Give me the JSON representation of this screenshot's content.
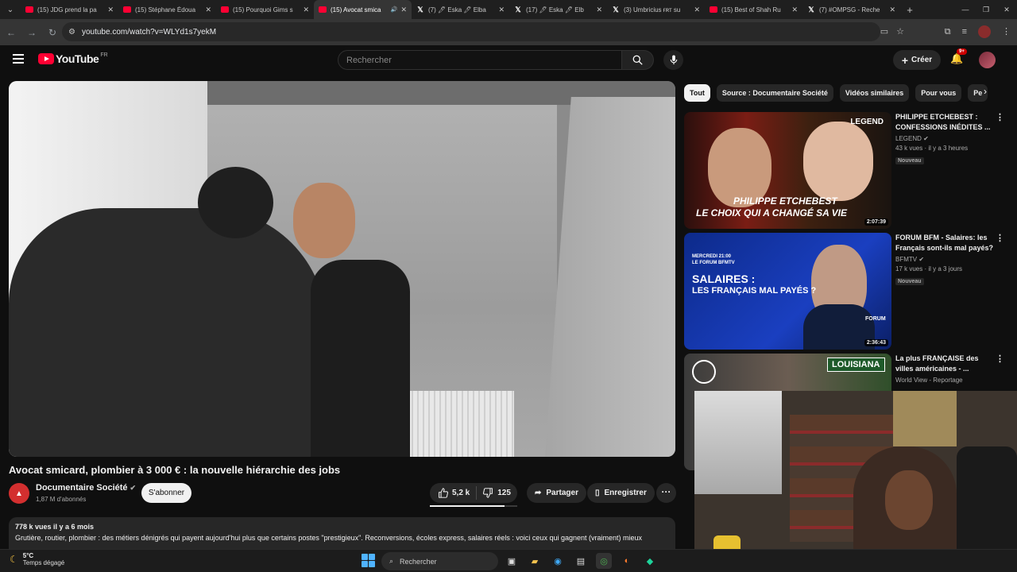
{
  "browser": {
    "tabs": [
      {
        "title": "(15) JDG prend la pa",
        "favicon": "youtube-icon"
      },
      {
        "title": "(15) Stéphane Édoua",
        "favicon": "youtube-icon"
      },
      {
        "title": "(15) Pourquoi Gims s",
        "favicon": "youtube-icon"
      },
      {
        "title": "(15) Avocat smica",
        "favicon": "youtube-icon",
        "active": true
      },
      {
        "title": "(7) 🖊 Eska 🖊 Elba",
        "favicon": "x-icon"
      },
      {
        "title": "(17) 🖊 Eska 🖊 Elb",
        "favicon": "x-icon"
      },
      {
        "title": "(3) Umbricius ғʀт su",
        "favicon": "x-icon"
      },
      {
        "title": "(15) Best of Shah Ru",
        "favicon": "youtube-icon"
      },
      {
        "title": "(7) #OMPSG - Reche",
        "favicon": "x-icon"
      }
    ],
    "url": "youtube.com/watch?v=WLYd1s7yekM"
  },
  "youtube": {
    "logo_text": "YouTube",
    "country": "FR",
    "search_placeholder": "Rechercher",
    "create_label": "Créer",
    "notification_count": "9+"
  },
  "video": {
    "title": "Avocat smicard, plombier à 3 000 € : la nouvelle hiérarchie des jobs",
    "channel": "Documentaire Société",
    "subscribers": "1,87 M d'abonnés",
    "subscribe_label": "S'abonner",
    "likes": "5,2 k",
    "dislikes": "125",
    "like_ratio": 0.85,
    "share_label": "Partager",
    "save_label": "Enregistrer",
    "stats": "778 k vues  il y a 6 mois",
    "description": "Grutière, routier, plombier : des métiers dénigrés qui payent aujourd'hui plus que certains postes \"prestigieux\". Reconversions, écoles express, salaires réels : voici ceux qui gagnent (vraiment) mieux"
  },
  "sidebar": {
    "chips": [
      "Tout",
      "Source : Documentaire Société",
      "Vidéos similaires",
      "Pour vous",
      "Pe"
    ],
    "recommendations": [
      {
        "title": "PHILIPPE ETCHEBEST : CONFESSIONS INÉDITES ...",
        "channel": "LEGEND",
        "meta": "43 k vues · il y a 3 heures",
        "badge": "Nouveau",
        "duration": "2:07:39",
        "thumb_brand": "LEGEND",
        "thumb_line1": "PHILIPPE ETCHEBEST",
        "thumb_line2": "LE CHOIX QUI A CHANGÉ SA VIE"
      },
      {
        "title": "FORUM BFM - Salaires: les Français sont-ils mal payés?",
        "channel": "BFMTV",
        "meta": "17 k vues · il y a 3 jours",
        "badge": "Nouveau",
        "duration": "2:36:43",
        "thumb_line0": "MERCREDI 21:00",
        "thumb_line1": "LE FORUM BFMTV",
        "thumb_line2": "SALAIRES :",
        "thumb_line3": "LES FRANÇAIS MAL PAYÉS ?",
        "thumb_brand": "FORUM"
      },
      {
        "title": "La plus FRANÇAISE des villes américaines - ...",
        "channel": "World View - Reportage",
        "meta": "",
        "thumb_line1": "LOUISIANA"
      }
    ]
  },
  "taskbar": {
    "temperature": "5°C",
    "weather": "Temps dégagé",
    "search_label": "Rechercher"
  }
}
